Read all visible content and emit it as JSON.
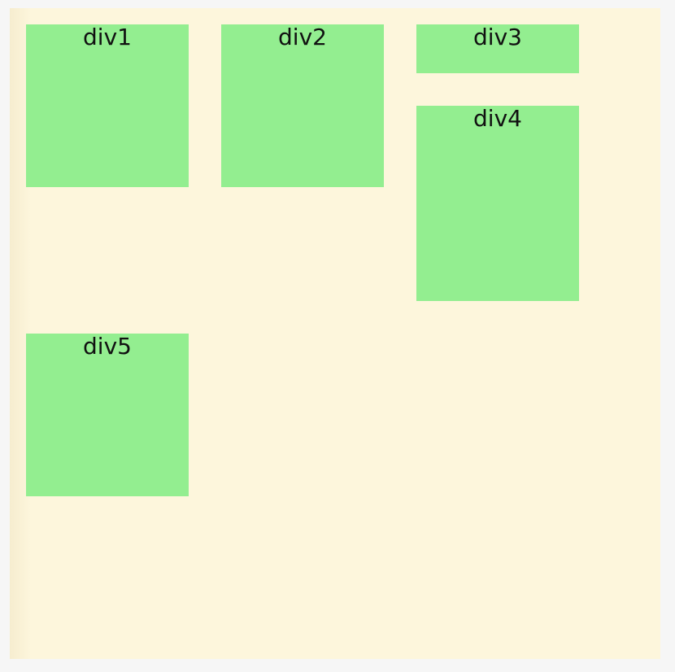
{
  "colors": {
    "container_background": "#fdf6dc",
    "box_background": "#93ee90",
    "text": "#111111"
  },
  "boxes": [
    {
      "label": "div1"
    },
    {
      "label": "div2"
    },
    {
      "label": "div3"
    },
    {
      "label": "div4"
    },
    {
      "label": "div5"
    }
  ]
}
